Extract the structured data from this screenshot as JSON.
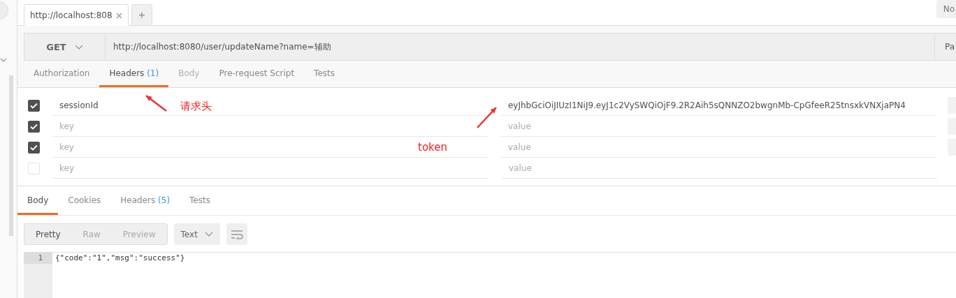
{
  "request_tabs": [
    {
      "label": "http://localhost:808",
      "selected": true
    }
  ],
  "new_tab": "+",
  "corner_button": "No",
  "request": {
    "method": "GET",
    "url": "http://localhost:8080/user/updateName?name=辅助",
    "side_button": "Pa"
  },
  "request_sections": [
    {
      "label": "Authorization",
      "selected": false,
      "disabled": false
    },
    {
      "label": "Headers",
      "count": "(1)",
      "selected": true,
      "disabled": false
    },
    {
      "label": "Body",
      "selected": false,
      "disabled": true
    },
    {
      "label": "Pre-request Script",
      "selected": false,
      "disabled": false
    },
    {
      "label": "Tests",
      "selected": false,
      "disabled": false
    }
  ],
  "headers": [
    {
      "checked": true,
      "key": "sessionId",
      "value": "eyJhbGciOiJIUzI1NiJ9.eyJ1c2VySWQiOjF9.2R2Aih5sQNNZO2bwgnMb-CpGfeeR25tnsxkVNXjaPN4"
    },
    {
      "checked": true,
      "key_placeholder": "key",
      "value_placeholder": "value"
    },
    {
      "checked": true,
      "key_placeholder": "key",
      "value_placeholder": "value"
    },
    {
      "checked": false,
      "key_placeholder": "key",
      "value_placeholder": "value"
    }
  ],
  "annotations": [
    {
      "text": "请求头"
    },
    {
      "text": "token"
    }
  ],
  "response_sections": [
    {
      "label": "Body",
      "selected": true
    },
    {
      "label": "Cookies",
      "selected": false
    },
    {
      "label": "Headers",
      "count": "(5)",
      "selected": false
    },
    {
      "label": "Tests",
      "selected": false
    }
  ],
  "view_modes": [
    {
      "label": "Pretty",
      "selected": true
    },
    {
      "label": "Raw",
      "selected": false
    },
    {
      "label": "Preview",
      "selected": false
    }
  ],
  "format": "Text",
  "response_lines": [
    {
      "number": "1",
      "text": "{\"code\":\"1\",\"msg\":\"success\"}"
    }
  ]
}
